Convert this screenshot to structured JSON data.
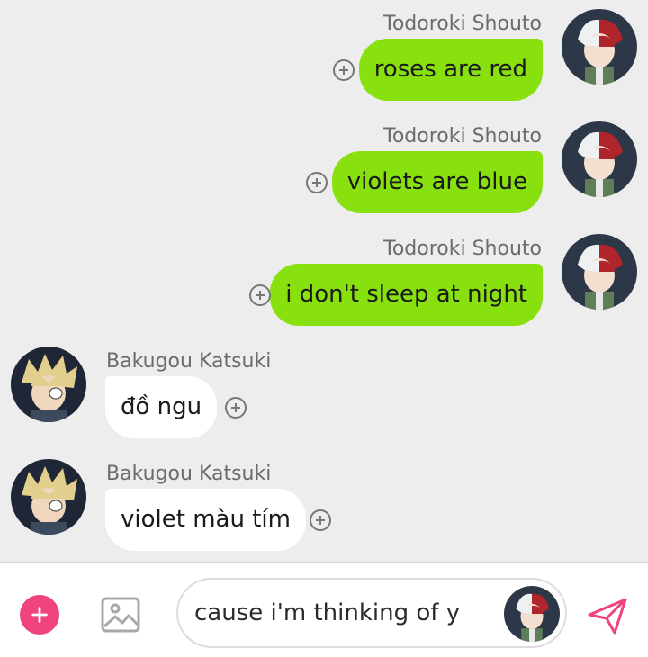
{
  "messages": [
    {
      "sender": "Todoroki Shouto",
      "text": "roses are red"
    },
    {
      "sender": "Todoroki Shouto",
      "text": "violets are blue"
    },
    {
      "sender": "Todoroki Shouto",
      "text": "i don't sleep at night"
    },
    {
      "sender": "Bakugou Katsuki",
      "text": "đồ ngu"
    },
    {
      "sender": "Bakugou Katsuki",
      "text": "violet màu tím"
    }
  ],
  "composer": {
    "input_value": "cause i'm thinking of y"
  },
  "colors": {
    "sent_bubble": "#88e10e",
    "received_bubble": "#ffffff",
    "background": "#ededed",
    "accent": "#f0447f"
  },
  "icons": {
    "add": "plus-icon",
    "image": "image-icon",
    "send": "send-icon",
    "react": "add-reaction-icon"
  }
}
